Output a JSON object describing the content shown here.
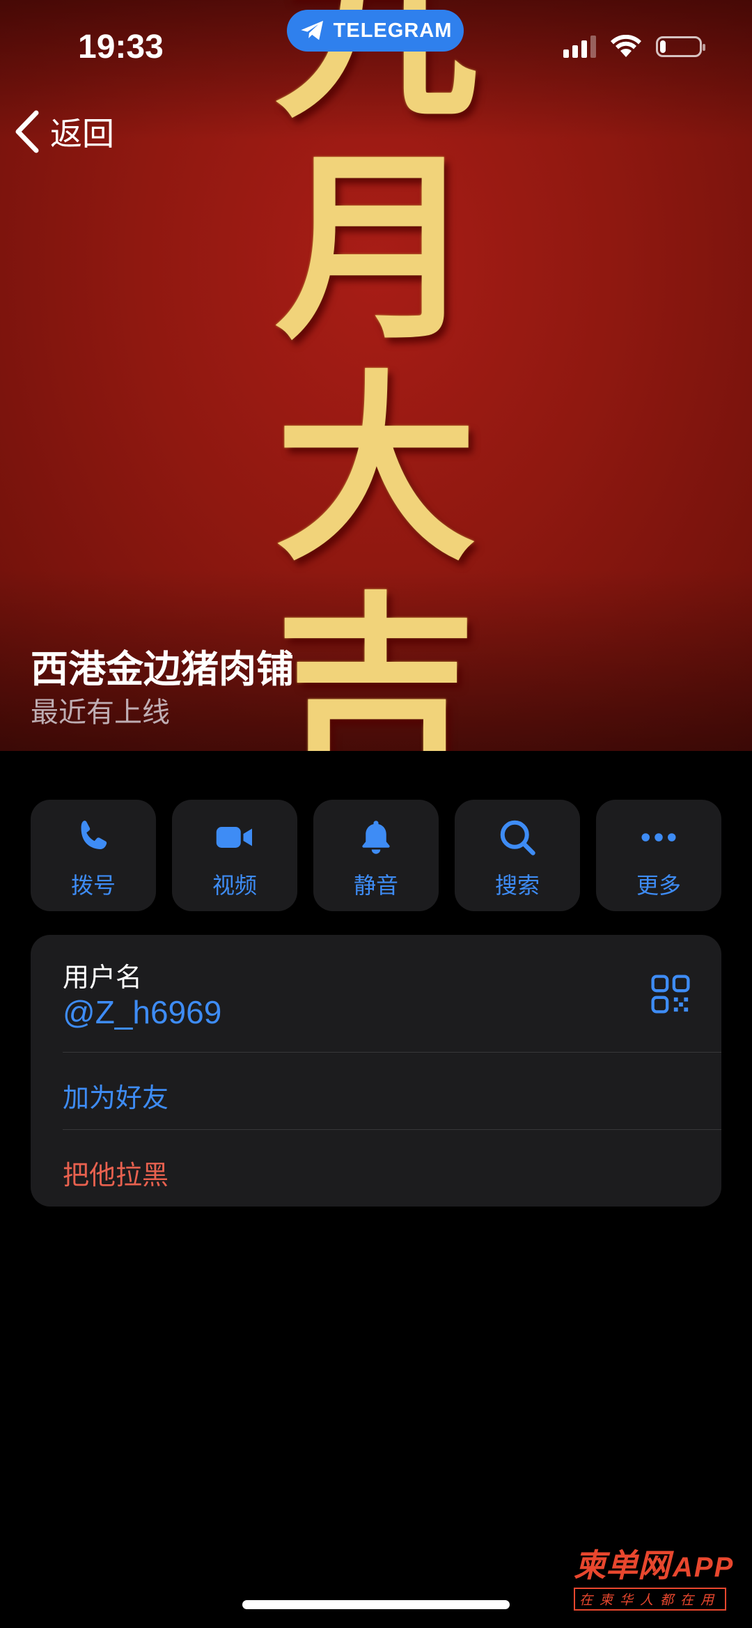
{
  "status_bar": {
    "time": "19:33",
    "app_pill": "TELEGRAM",
    "battery_level": 0.15
  },
  "nav": {
    "back_label": "返回"
  },
  "hero": {
    "calligraphy": [
      "九",
      "月",
      "大",
      "吉"
    ]
  },
  "profile": {
    "name": "西港金边猪肉铺",
    "status": "最近有上线"
  },
  "actions": [
    {
      "label": "拨号",
      "icon": "phone-icon"
    },
    {
      "label": "视频",
      "icon": "video-camera-icon"
    },
    {
      "label": "静音",
      "icon": "bell-icon"
    },
    {
      "label": "搜索",
      "icon": "search-icon"
    },
    {
      "label": "更多",
      "icon": "more-dots-icon"
    }
  ],
  "info": {
    "username_label": "用户名",
    "username_value": "@Z_h6969",
    "add_friend": "加为好友",
    "block": "把他拉黑"
  },
  "colors": {
    "accent": "#3e8cf5",
    "destructive": "#e8614f",
    "card_bg": "#1c1c1e",
    "hero_red": "#8f1810",
    "calligraphy_gold": "#f1d37a"
  },
  "watermark": {
    "brand_cn": "柬单网",
    "brand_en": "APP",
    "tagline": "在柬华人都在用"
  }
}
